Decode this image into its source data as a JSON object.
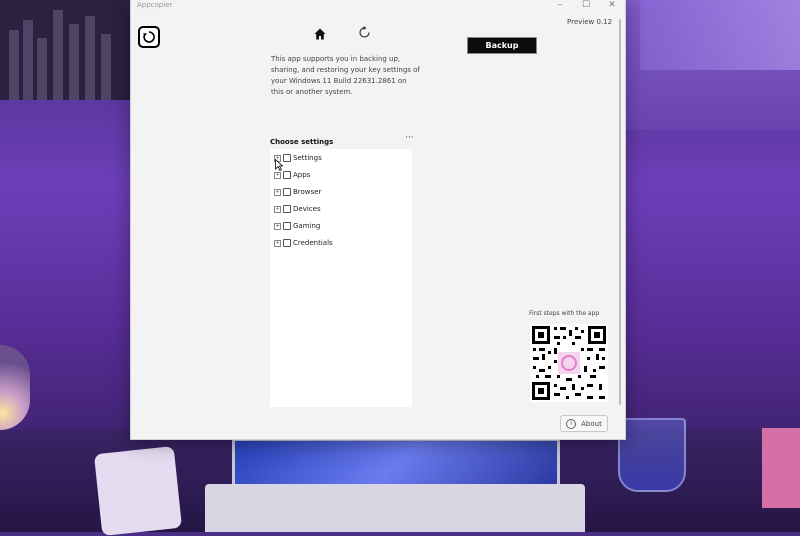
{
  "window": {
    "title": "Appcopier",
    "minimize": "–",
    "maximize": "☐",
    "close": "✕"
  },
  "header": {
    "preview_label": "Preview 0.12",
    "backup_label": "Backup"
  },
  "description": "This app supports you in backing up, sharing, and restoring your key settings of your Windows 11 Build 22631.2861 on this or another system.",
  "settings": {
    "heading": "Choose settings",
    "more_label": "···",
    "expander": "+",
    "items": [
      {
        "label": "Settings",
        "checked": false
      },
      {
        "label": "Apps",
        "checked": false
      },
      {
        "label": "Browser",
        "checked": false
      },
      {
        "label": "Devices",
        "checked": false
      },
      {
        "label": "Gaming",
        "checked": false
      },
      {
        "label": "Credentials",
        "checked": false
      }
    ]
  },
  "qr": {
    "caption": "First steps with the app"
  },
  "footer": {
    "about_label": "About",
    "info_glyph": "i"
  },
  "icons": {
    "logo": "refresh-circle-logo",
    "home": "home-icon",
    "refresh": "refresh-icon"
  },
  "colors": {
    "backup_button": "#0b0b0b",
    "qr_accent": "#e27fc8"
  }
}
